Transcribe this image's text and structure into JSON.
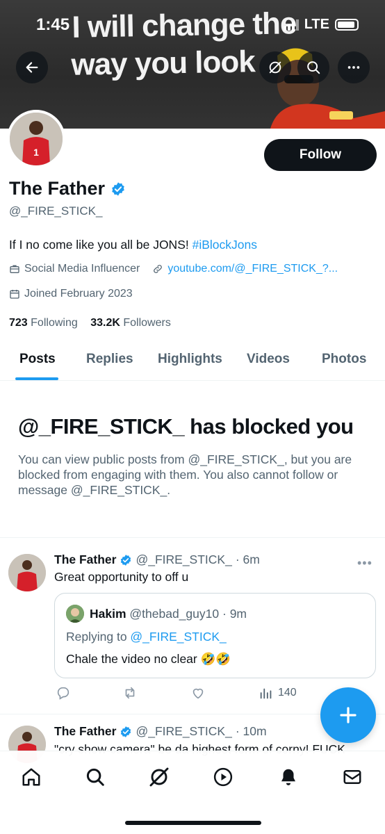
{
  "status_bar": {
    "time": "1:45",
    "network": "LTE"
  },
  "banner": {
    "line1": "I will change the",
    "line2": "way you look"
  },
  "header_buttons": {
    "back_icon": "arrow-left-icon",
    "grok_icon": "grok-icon",
    "search_icon": "search-icon",
    "more_icon": "more-icon"
  },
  "profile": {
    "follow_label": "Follow",
    "display_name": "The Father",
    "handle": "@_FIRE_STICK_",
    "bio_text": "If I no come like you all be JONS! ",
    "bio_hashtag": "#iBlockJons",
    "category": "Social Media Influencer",
    "link": "youtube.com/@_FIRE_STICK_?...",
    "joined": "Joined February 2023",
    "following_count": "723",
    "following_label": "Following",
    "followers_count": "33.2K",
    "followers_label": "Followers"
  },
  "tabs": [
    {
      "label": "Posts",
      "active": true
    },
    {
      "label": "Replies"
    },
    {
      "label": "Highlights"
    },
    {
      "label": "Videos"
    },
    {
      "label": "Photos"
    }
  ],
  "blocked": {
    "title": "@_FIRE_STICK_ has blocked you",
    "description": "You can view public posts from @_FIRE_STICK_, but you are blocked from engaging with them. You also cannot follow or message @_FIRE_STICK_."
  },
  "posts": [
    {
      "name": "The Father",
      "handle": "@_FIRE_STICK_",
      "time": "· 6m",
      "text": "Great opportunity to off u",
      "quote": {
        "name": "Hakim",
        "handle": "@thebad_guy10",
        "time": "· 9m",
        "replying_prefix": "Replying to ",
        "replying_to": "@_FIRE_STICK_",
        "text": "Chale the video no clear 🤣🤣"
      },
      "views": "140"
    },
    {
      "name": "The Father",
      "handle": "@_FIRE_STICK_",
      "time": "· 10m",
      "text": "\"cry show camera\" be da highest form of corny! FUCK"
    }
  ],
  "bottom_nav": [
    "home-icon",
    "search-icon",
    "grok-icon",
    "play-icon",
    "bell-icon",
    "mail-icon"
  ],
  "colors": {
    "accent": "#1d9bf0",
    "text": "#0f1419",
    "secondary": "#536471"
  }
}
